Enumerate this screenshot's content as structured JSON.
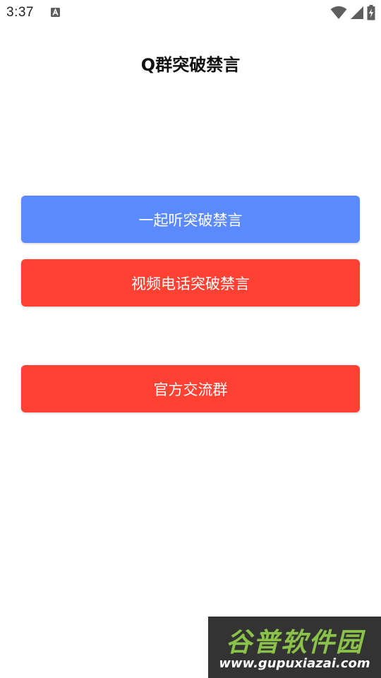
{
  "status_bar": {
    "time": "3:37",
    "icons": [
      "notification-a-icon",
      "wifi-icon",
      "signal-icon",
      "battery-charging-icon"
    ]
  },
  "app": {
    "title": "Q群突破禁言"
  },
  "buttons": {
    "listen_together": "一起听突破禁言",
    "video_call": "视频电话突破禁言",
    "official_group": "官方交流群"
  },
  "colors": {
    "blue_button": "#5b8afc",
    "red_button": "#fe4132",
    "watermark_green": "#8bc34a",
    "watermark_bg": "#333333"
  },
  "watermark": {
    "brand": "谷普软件园",
    "url": "www.gupuxiazai.com"
  }
}
